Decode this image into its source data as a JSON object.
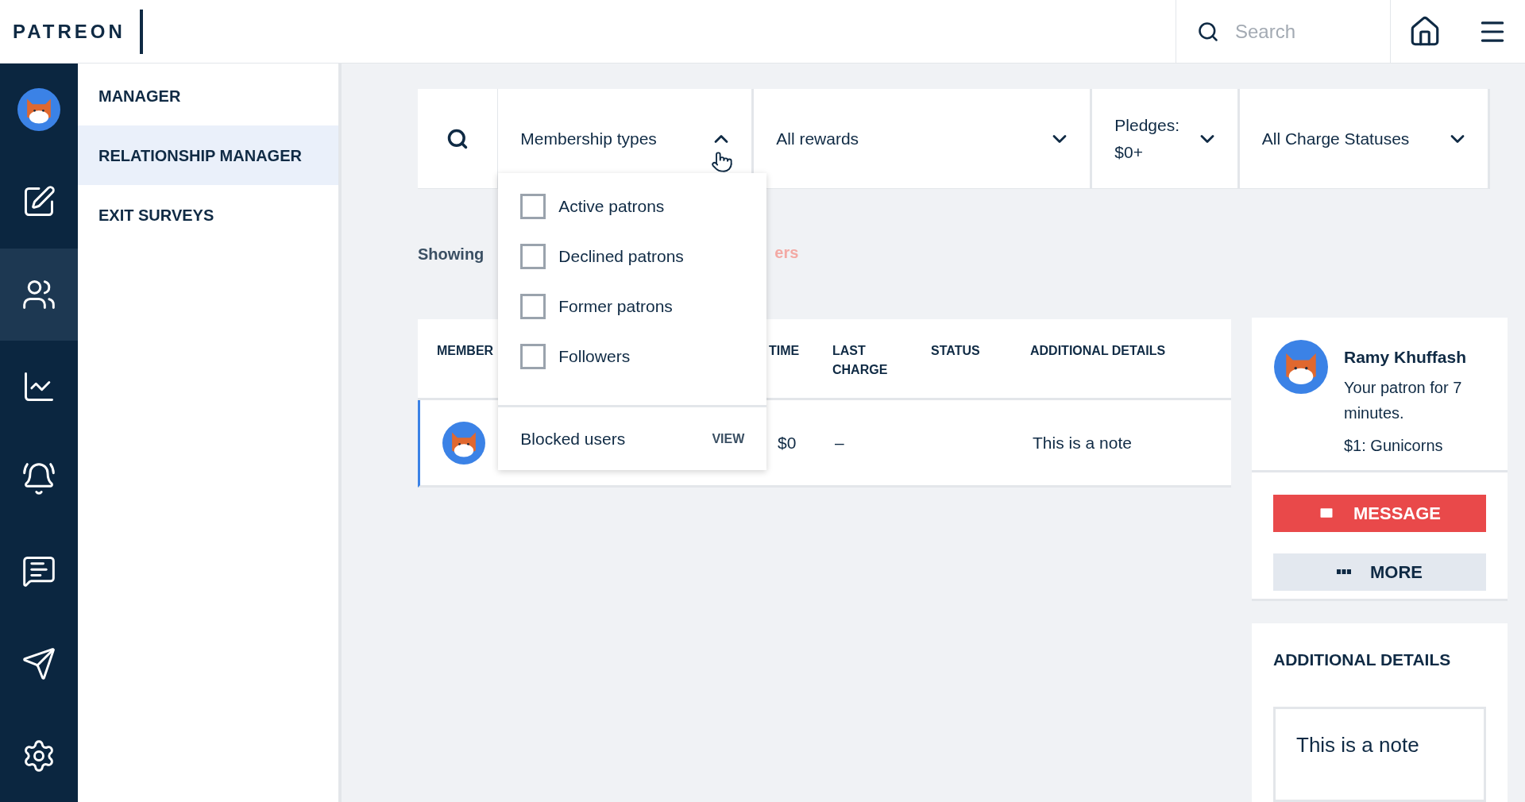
{
  "header": {
    "logo": "PATREON",
    "search": {
      "placeholder": "Search"
    }
  },
  "rail": [
    {
      "kind": "avatar",
      "selected": false
    },
    {
      "kind": "pen",
      "selected": false
    },
    {
      "kind": "users",
      "selected": true
    },
    {
      "kind": "chart",
      "selected": false
    },
    {
      "kind": "bell",
      "selected": false
    },
    {
      "kind": "message",
      "selected": false
    },
    {
      "kind": "send",
      "selected": false
    },
    {
      "kind": "settings",
      "selected": false
    }
  ],
  "subnav": [
    {
      "label": "MANAGER",
      "selected": false
    },
    {
      "label": "RELATIONSHIP MANAGER",
      "selected": true
    },
    {
      "label": "EXIT SURVEYS",
      "selected": false
    }
  ],
  "filters": [
    {
      "label": "Membership types",
      "expanded": true
    },
    {
      "label": "All rewards",
      "expanded": false
    },
    {
      "label": "Pledges: $0+",
      "expanded": false
    },
    {
      "label": "All Charge Statuses",
      "expanded": false
    }
  ],
  "dropdown": {
    "options": [
      {
        "label": "Active patrons",
        "checked": false
      },
      {
        "label": "Declined patrons",
        "checked": false
      },
      {
        "label": "Former patrons",
        "checked": false
      },
      {
        "label": "Followers",
        "checked": false
      }
    ],
    "footer": {
      "label": "Blocked users",
      "action": "VIEW"
    }
  },
  "showing": {
    "text": "Showing",
    "link": "ers"
  },
  "table": {
    "columns": [
      "MEMBER",
      "TIME",
      "LAST CHARGE",
      "STATUS",
      "ADDITIONAL DETAILS"
    ],
    "rows": [
      {
        "selected": true,
        "time": "$0",
        "last_charge": "–",
        "details": "This is a note"
      }
    ]
  },
  "patron": {
    "name": "Ramy Khuffash",
    "since": "Your patron for 7 minutes.",
    "tier": "$1: Gunicorns",
    "buttons": [
      {
        "kind": "message",
        "label": "MESSAGE"
      },
      {
        "kind": "more",
        "label": "MORE"
      }
    ]
  },
  "details": {
    "title": "ADDITIONAL DETAILS",
    "note": "This is a note"
  }
}
